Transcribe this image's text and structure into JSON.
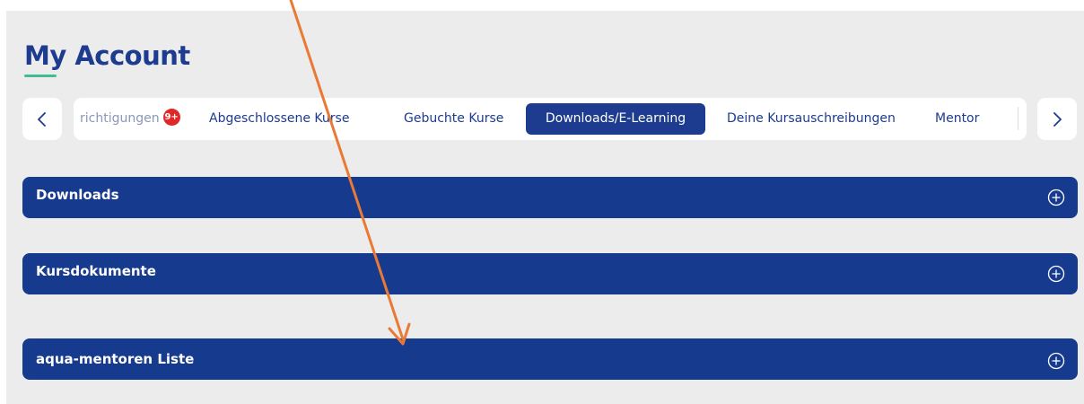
{
  "header": {
    "title": "My Account"
  },
  "tabs": {
    "partial_label": "richtigungen",
    "partial_badge": "9+",
    "items": [
      {
        "label": "Abgeschlossene Kurse"
      },
      {
        "label": "Gebuchte Kurse"
      },
      {
        "label": "Downloads/E-Learning",
        "active": true
      },
      {
        "label": "Deine Kursauschreibungen"
      },
      {
        "label": "Mentor"
      }
    ],
    "prev_icon": "chevron-left-icon",
    "next_icon": "chevron-right-icon"
  },
  "sections": [
    {
      "label": "Downloads",
      "icon": "plus-circle-icon"
    },
    {
      "label": "Kursdokumente",
      "icon": "plus-circle-icon"
    },
    {
      "label": "aqua-mentoren Liste",
      "icon": "plus-circle-icon"
    }
  ],
  "colors": {
    "brand": "#163a8e",
    "accent_underline": "#3fbf8f",
    "badge": "#e02828",
    "annotation_arrow": "#e87a35",
    "background": "#ececec"
  }
}
